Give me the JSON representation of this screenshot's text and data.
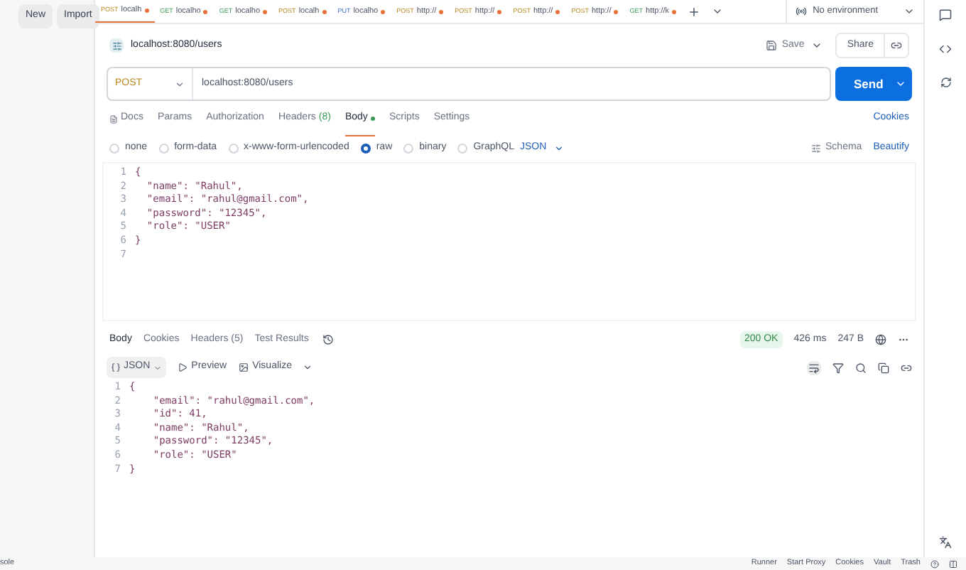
{
  "sidebar": {
    "buttons": [
      "New",
      "Import"
    ],
    "footer_text": "sole"
  },
  "tabs": [
    {
      "method": "POST",
      "label": "localh",
      "selected": true
    },
    {
      "method": "GET",
      "label": "localho",
      "selected": false
    },
    {
      "method": "GET",
      "label": "localho",
      "selected": false
    },
    {
      "method": "POST",
      "label": "localh",
      "selected": false
    },
    {
      "method": "PUT",
      "label": "localho",
      "selected": false
    },
    {
      "method": "POST",
      "label": "http://",
      "selected": false
    },
    {
      "method": "POST",
      "label": "http://",
      "selected": false
    },
    {
      "method": "POST",
      "label": "http://",
      "selected": false
    },
    {
      "method": "POST",
      "label": "http://",
      "selected": false
    },
    {
      "method": "GET",
      "label": "http://k",
      "selected": false
    }
  ],
  "environment": "No environment",
  "request": {
    "title": "localhost:8080/users",
    "save": "Save",
    "share": "Share",
    "method": "POST",
    "url": "localhost:8080/users",
    "send": "Send"
  },
  "request_tabs": [
    {
      "label": "Docs",
      "selected": false
    },
    {
      "label": "Params",
      "selected": false
    },
    {
      "label": "Authorization",
      "selected": false
    },
    {
      "label": "Headers",
      "count": "(8)",
      "selected": false
    },
    {
      "label": "Body",
      "selected": true
    },
    {
      "label": "Scripts",
      "selected": false
    },
    {
      "label": "Settings",
      "selected": false
    }
  ],
  "cookies_link": "Cookies",
  "body_types": [
    {
      "label": "none",
      "selected": false
    },
    {
      "label": "form-data",
      "selected": false
    },
    {
      "label": "x-www-form-urlencoded",
      "selected": false
    },
    {
      "label": "raw",
      "selected": true
    },
    {
      "label": "binary",
      "selected": false
    },
    {
      "label": "GraphQL",
      "selected": false
    }
  ],
  "body_format": "JSON",
  "schema": "Schema",
  "beautify": "Beautify",
  "request_body": [
    {
      "n": "1",
      "text": "{"
    },
    {
      "n": "2",
      "text": "  \"name\": \"Rahul\","
    },
    {
      "n": "3",
      "text": "  \"email\": \"rahul@gmail.com\","
    },
    {
      "n": "4",
      "text": "  \"password\": \"12345\","
    },
    {
      "n": "5",
      "text": "  \"role\": \"USER\""
    },
    {
      "n": "6",
      "text": "}"
    },
    {
      "n": "7"
    }
  ],
  "response_tabs": [
    {
      "label": "Body",
      "selected": true
    },
    {
      "label": "Cookies",
      "selected": false
    },
    {
      "label": "Headers (5)",
      "selected": false
    },
    {
      "label": "Test Results",
      "selected": false
    }
  ],
  "status": "200 OK",
  "time": "426 ms",
  "size": "247 B",
  "response_format": "JSON",
  "preview": "Preview",
  "visualize": "Visualize",
  "response_body": [
    {
      "n": "1",
      "text": "{"
    },
    {
      "n": "2",
      "text": "    \"email\": \"rahul@gmail.com\","
    },
    {
      "n": "3",
      "text": "    \"id\": 41,"
    },
    {
      "n": "4",
      "text": "    \"name\": \"Rahul\","
    },
    {
      "n": "5",
      "text": "    \"password\": \"12345\","
    },
    {
      "n": "6",
      "text": "    \"role\": \"USER\""
    },
    {
      "n": "7",
      "text": "}"
    }
  ],
  "status_bar": [
    "Runner",
    "Start Proxy",
    "Cookies",
    "Vault",
    "Trash"
  ]
}
